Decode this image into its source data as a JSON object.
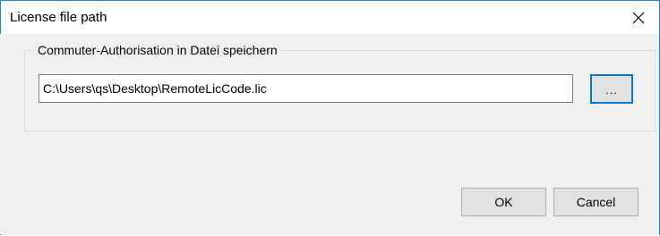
{
  "window": {
    "title": "License file path",
    "close_icon": "close-icon"
  },
  "group": {
    "label": "Commuter-Authorisation in Datei speichern",
    "path_value": "C:\\Users\\qs\\Desktop\\RemoteLicCode.lic",
    "browse_label": "..."
  },
  "buttons": {
    "ok_label": "OK",
    "cancel_label": "Cancel"
  },
  "colors": {
    "accent": "#0078d7",
    "window_border": "#1883d7",
    "client_bg": "#f0f0f0",
    "button_bg": "#e1e1e1"
  }
}
